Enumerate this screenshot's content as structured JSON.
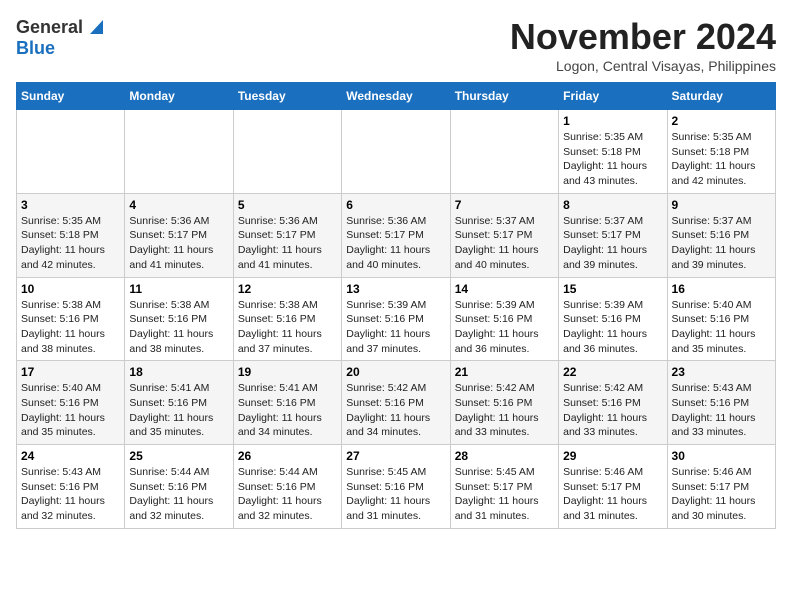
{
  "logo": {
    "general": "General",
    "blue": "Blue"
  },
  "header": {
    "month": "November 2024",
    "location": "Logon, Central Visayas, Philippines"
  },
  "weekdays": [
    "Sunday",
    "Monday",
    "Tuesday",
    "Wednesday",
    "Thursday",
    "Friday",
    "Saturday"
  ],
  "weeks": [
    [
      {
        "day": "",
        "info": ""
      },
      {
        "day": "",
        "info": ""
      },
      {
        "day": "",
        "info": ""
      },
      {
        "day": "",
        "info": ""
      },
      {
        "day": "",
        "info": ""
      },
      {
        "day": "1",
        "info": "Sunrise: 5:35 AM\nSunset: 5:18 PM\nDaylight: 11 hours and 43 minutes."
      },
      {
        "day": "2",
        "info": "Sunrise: 5:35 AM\nSunset: 5:18 PM\nDaylight: 11 hours and 42 minutes."
      }
    ],
    [
      {
        "day": "3",
        "info": "Sunrise: 5:35 AM\nSunset: 5:18 PM\nDaylight: 11 hours and 42 minutes."
      },
      {
        "day": "4",
        "info": "Sunrise: 5:36 AM\nSunset: 5:17 PM\nDaylight: 11 hours and 41 minutes."
      },
      {
        "day": "5",
        "info": "Sunrise: 5:36 AM\nSunset: 5:17 PM\nDaylight: 11 hours and 41 minutes."
      },
      {
        "day": "6",
        "info": "Sunrise: 5:36 AM\nSunset: 5:17 PM\nDaylight: 11 hours and 40 minutes."
      },
      {
        "day": "7",
        "info": "Sunrise: 5:37 AM\nSunset: 5:17 PM\nDaylight: 11 hours and 40 minutes."
      },
      {
        "day": "8",
        "info": "Sunrise: 5:37 AM\nSunset: 5:17 PM\nDaylight: 11 hours and 39 minutes."
      },
      {
        "day": "9",
        "info": "Sunrise: 5:37 AM\nSunset: 5:16 PM\nDaylight: 11 hours and 39 minutes."
      }
    ],
    [
      {
        "day": "10",
        "info": "Sunrise: 5:38 AM\nSunset: 5:16 PM\nDaylight: 11 hours and 38 minutes."
      },
      {
        "day": "11",
        "info": "Sunrise: 5:38 AM\nSunset: 5:16 PM\nDaylight: 11 hours and 38 minutes."
      },
      {
        "day": "12",
        "info": "Sunrise: 5:38 AM\nSunset: 5:16 PM\nDaylight: 11 hours and 37 minutes."
      },
      {
        "day": "13",
        "info": "Sunrise: 5:39 AM\nSunset: 5:16 PM\nDaylight: 11 hours and 37 minutes."
      },
      {
        "day": "14",
        "info": "Sunrise: 5:39 AM\nSunset: 5:16 PM\nDaylight: 11 hours and 36 minutes."
      },
      {
        "day": "15",
        "info": "Sunrise: 5:39 AM\nSunset: 5:16 PM\nDaylight: 11 hours and 36 minutes."
      },
      {
        "day": "16",
        "info": "Sunrise: 5:40 AM\nSunset: 5:16 PM\nDaylight: 11 hours and 35 minutes."
      }
    ],
    [
      {
        "day": "17",
        "info": "Sunrise: 5:40 AM\nSunset: 5:16 PM\nDaylight: 11 hours and 35 minutes."
      },
      {
        "day": "18",
        "info": "Sunrise: 5:41 AM\nSunset: 5:16 PM\nDaylight: 11 hours and 35 minutes."
      },
      {
        "day": "19",
        "info": "Sunrise: 5:41 AM\nSunset: 5:16 PM\nDaylight: 11 hours and 34 minutes."
      },
      {
        "day": "20",
        "info": "Sunrise: 5:42 AM\nSunset: 5:16 PM\nDaylight: 11 hours and 34 minutes."
      },
      {
        "day": "21",
        "info": "Sunrise: 5:42 AM\nSunset: 5:16 PM\nDaylight: 11 hours and 33 minutes."
      },
      {
        "day": "22",
        "info": "Sunrise: 5:42 AM\nSunset: 5:16 PM\nDaylight: 11 hours and 33 minutes."
      },
      {
        "day": "23",
        "info": "Sunrise: 5:43 AM\nSunset: 5:16 PM\nDaylight: 11 hours and 33 minutes."
      }
    ],
    [
      {
        "day": "24",
        "info": "Sunrise: 5:43 AM\nSunset: 5:16 PM\nDaylight: 11 hours and 32 minutes."
      },
      {
        "day": "25",
        "info": "Sunrise: 5:44 AM\nSunset: 5:16 PM\nDaylight: 11 hours and 32 minutes."
      },
      {
        "day": "26",
        "info": "Sunrise: 5:44 AM\nSunset: 5:16 PM\nDaylight: 11 hours and 32 minutes."
      },
      {
        "day": "27",
        "info": "Sunrise: 5:45 AM\nSunset: 5:16 PM\nDaylight: 11 hours and 31 minutes."
      },
      {
        "day": "28",
        "info": "Sunrise: 5:45 AM\nSunset: 5:17 PM\nDaylight: 11 hours and 31 minutes."
      },
      {
        "day": "29",
        "info": "Sunrise: 5:46 AM\nSunset: 5:17 PM\nDaylight: 11 hours and 31 minutes."
      },
      {
        "day": "30",
        "info": "Sunrise: 5:46 AM\nSunset: 5:17 PM\nDaylight: 11 hours and 30 minutes."
      }
    ]
  ]
}
